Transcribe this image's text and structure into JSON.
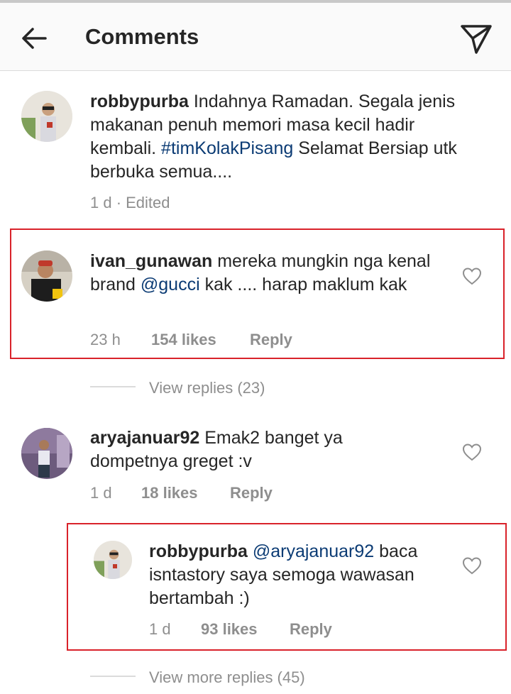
{
  "header": {
    "title": "Comments",
    "back_icon": "arrow-left-icon",
    "send_icon": "paper-plane-icon"
  },
  "comments": [
    {
      "username": "robbypurba",
      "text_before": " Indahnya Ramadan. Segala jenis makanan penuh memori masa kecil hadir kembali. ",
      "hashtag": "#timKolakPisang",
      "text_after": " Selamat Bersiap utk berbuka semua....",
      "time": "1 d · Edited"
    },
    {
      "username": "ivan_gunawan",
      "text_before": " mereka mungkin nga kenal brand ",
      "mention": "@gucci",
      "text_after": "  kak .... harap maklum kak",
      "time": "23 h",
      "likes": "154 likes",
      "reply": "Reply",
      "view_replies": "View replies (23)"
    },
    {
      "username": "aryajanuar92",
      "text": " Emak2 banget ya dompetnya greget :v",
      "time": "1 d",
      "likes": "18 likes",
      "reply": "Reply"
    },
    {
      "username": "robbypurba",
      "mention": "@aryajanuar92",
      "text_after": " baca isntastory saya semoga wawasan bertambah :)",
      "time": "1 d",
      "likes": "93 likes",
      "reply": "Reply",
      "view_replies": "View more replies (45)"
    }
  ],
  "colors": {
    "highlight_box": "#d9222a",
    "link": "#0b3b74",
    "muted": "#8e8e8e"
  }
}
